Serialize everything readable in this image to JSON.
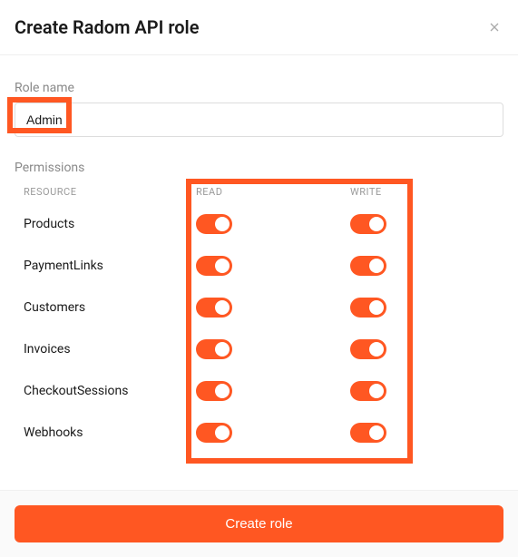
{
  "header": {
    "title": "Create Radom API role"
  },
  "form": {
    "roleNameLabel": "Role name",
    "roleNameValue": "Admin",
    "permissionsLabel": "Permissions",
    "columns": {
      "resource": "RESOURCE",
      "read": "READ",
      "write": "WRITE"
    },
    "rows": [
      {
        "name": "Products",
        "read": true,
        "write": true
      },
      {
        "name": "PaymentLinks",
        "read": true,
        "write": true
      },
      {
        "name": "Customers",
        "read": true,
        "write": true
      },
      {
        "name": "Invoices",
        "read": true,
        "write": true
      },
      {
        "name": "CheckoutSessions",
        "read": true,
        "write": true
      },
      {
        "name": "Webhooks",
        "read": true,
        "write": true
      }
    ]
  },
  "footer": {
    "submitLabel": "Create role"
  },
  "colors": {
    "accent": "#ff5722"
  }
}
